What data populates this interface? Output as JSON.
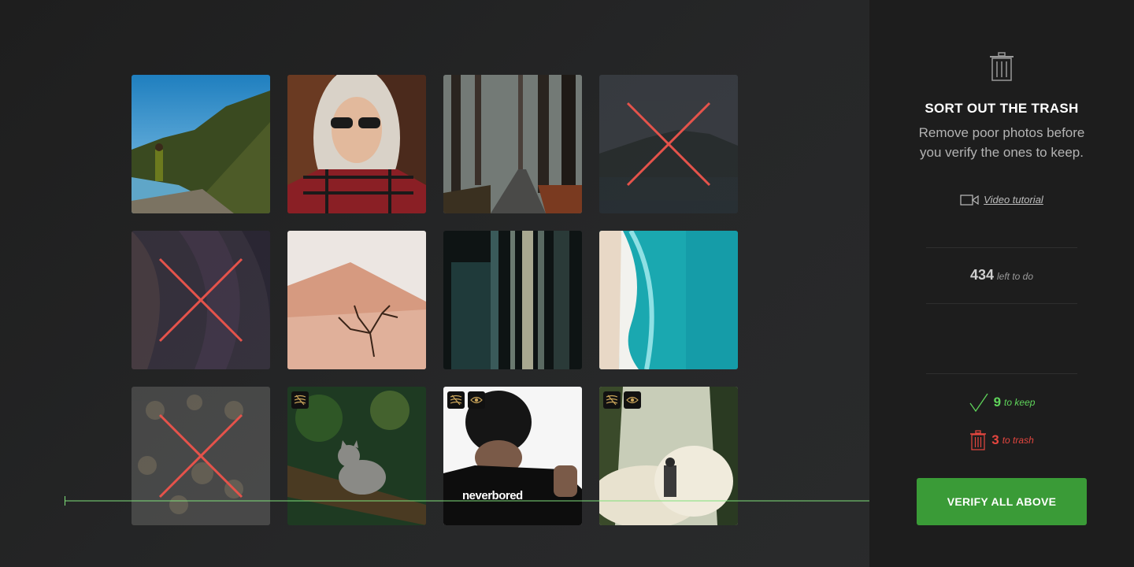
{
  "sidebar": {
    "title": "SORT OUT THE TRASH",
    "description": "Remove poor photos before you verify the ones to keep.",
    "video_link": "Video tutorial",
    "left_count": "434",
    "left_label": "left to do",
    "keep_count": "9",
    "keep_label": "to keep",
    "trash_count": "3",
    "trash_label": "to trash",
    "verify_button": "VERIFY ALL ABOVE"
  },
  "photos": [
    {
      "subject": "hiker-cliff-lake",
      "status": "keep"
    },
    {
      "subject": "woman-sunglasses",
      "status": "keep"
    },
    {
      "subject": "forest-road",
      "status": "keep"
    },
    {
      "subject": "mountain-lake-dusk",
      "status": "trash"
    },
    {
      "subject": "canyon-rock",
      "status": "trash"
    },
    {
      "subject": "desert-tree",
      "status": "keep"
    },
    {
      "subject": "blurred-building",
      "status": "keep"
    },
    {
      "subject": "ocean-aerial",
      "status": "keep"
    },
    {
      "subject": "mushrooms",
      "status": "trash"
    },
    {
      "subject": "cat-on-branch",
      "status": "keep",
      "badges": [
        "layers-icon"
      ]
    },
    {
      "subject": "man-beanie-shirt",
      "status": "keep",
      "badges": [
        "layers-icon",
        "eye-icon"
      ],
      "caption": "neverbored"
    },
    {
      "subject": "hiker-smoke-forest",
      "status": "keep",
      "badges": [
        "layers-icon",
        "eye-icon"
      ]
    }
  ],
  "colors": {
    "accent_green": "#3a9b37",
    "keep_green": "#5fd45a",
    "trash_red": "#e5463f",
    "badge_gold": "#c9a45a"
  }
}
